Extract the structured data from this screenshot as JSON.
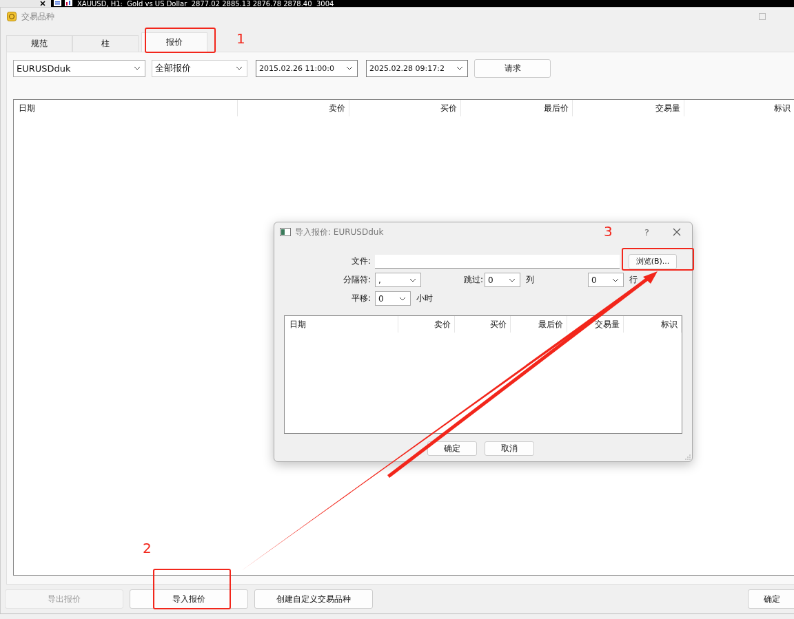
{
  "background_chart": {
    "title": "XAUUSD, H1:  Gold vs US Dollar  2877.02 2885.13 2876.78 2878.40  3004"
  },
  "window": {
    "title": "交易品种",
    "tabs": [
      {
        "label": "规范",
        "selected": false
      },
      {
        "label": "柱",
        "selected": false
      },
      {
        "label": "报价",
        "selected": true
      }
    ],
    "filters": {
      "symbol": "EURUSDduk",
      "quote_type": "全部报价",
      "from": "2015.02.26 11:00:0",
      "to": "2025.02.28 09:17:2",
      "request_button": "请求"
    },
    "table": {
      "columns": [
        {
          "label": "日期"
        },
        {
          "label": "卖价"
        },
        {
          "label": "买价"
        },
        {
          "label": "最后价"
        },
        {
          "label": "交易量"
        },
        {
          "label": "标识"
        }
      ]
    },
    "buttons": [
      {
        "label": "导出报价",
        "disabled": true
      },
      {
        "label": "导入报价",
        "disabled": false
      },
      {
        "label": "创建自定义交易品种",
        "disabled": false
      }
    ],
    "ok_button": "确定"
  },
  "dialog": {
    "title": "导入报价: EURUSDduk",
    "help": "?",
    "file_label": "文件:",
    "browse_button": "浏览(B)...",
    "separator_label": "分隔符:",
    "separator": ",",
    "skip_label": "跳过:",
    "skip_columns": "0",
    "columns_unit": "列",
    "skip_rows": "0",
    "rows_unit": "行",
    "shift_label": "平移:",
    "shift": "0",
    "shift_unit": "小时",
    "table": {
      "columns": [
        {
          "label": "日期"
        },
        {
          "label": "卖价"
        },
        {
          "label": "买价"
        },
        {
          "label": "最后价"
        },
        {
          "label": "交易量"
        },
        {
          "label": "标识"
        }
      ]
    },
    "buttons": [
      {
        "label": "确定"
      },
      {
        "label": "取消"
      }
    ]
  },
  "annotations": [
    {
      "label": "1"
    },
    {
      "label": "2"
    },
    {
      "label": "3"
    }
  ]
}
